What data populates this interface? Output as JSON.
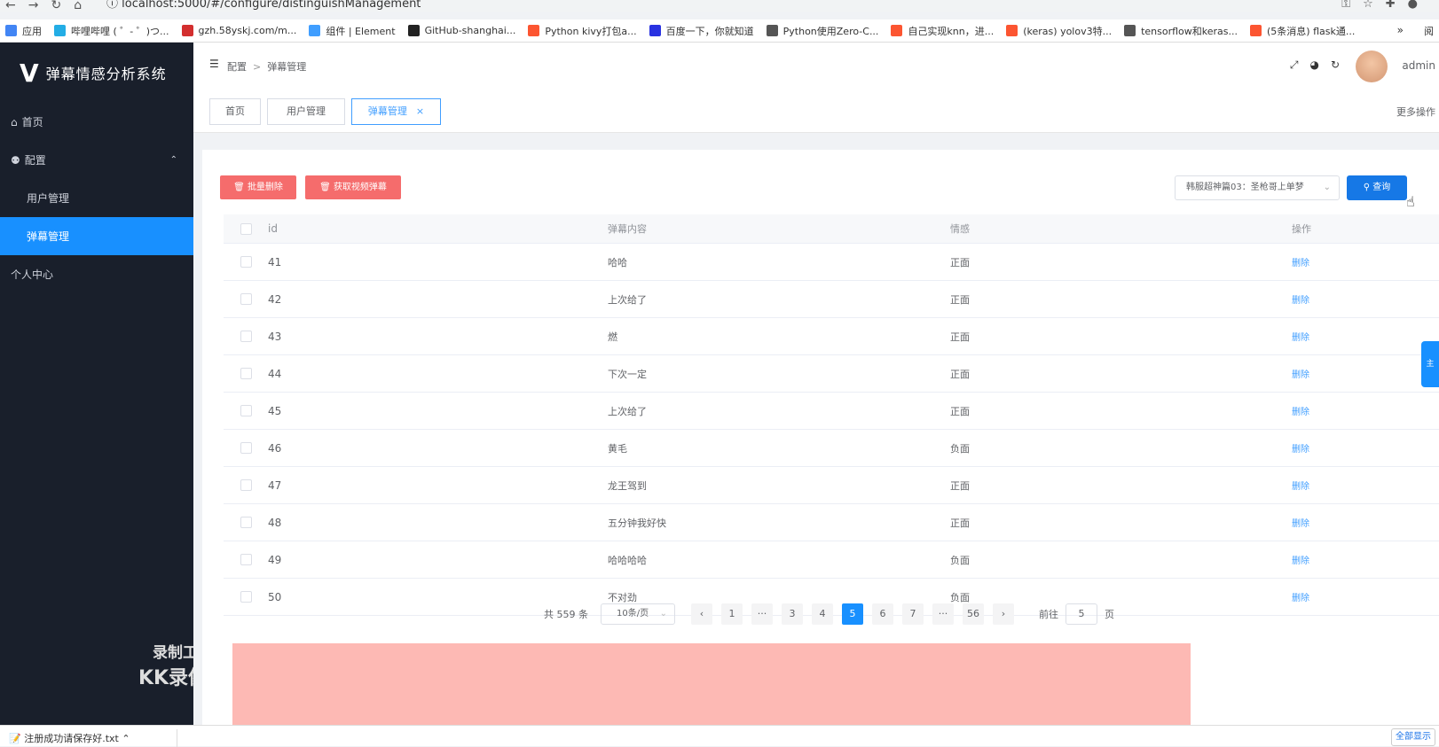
{
  "browser": {
    "url": "localhost:5000/#/configure/distinguishManagement",
    "bookmarks": [
      {
        "label": "应用",
        "color": "#4285f4"
      },
      {
        "label": "哔哩哔哩 ( ゜- ゜)つ...",
        "color": "#23ade5"
      },
      {
        "label": "gzh.58yskj.com/m...",
        "color": "#d32f2f"
      },
      {
        "label": "组件 | Element",
        "color": "#409eff"
      },
      {
        "label": "GitHub-shanghai...",
        "color": "#222222"
      },
      {
        "label": "Python kivy打包a...",
        "color": "#fc5531"
      },
      {
        "label": "百度一下，你就知道",
        "color": "#2932e1"
      },
      {
        "label": "Python使用Zero-C...",
        "color": "#555555"
      },
      {
        "label": "自己实现knn，进...",
        "color": "#fc5531"
      },
      {
        "label": "(keras) yolov3特...",
        "color": "#fc5531"
      },
      {
        "label": "tensorflow和keras...",
        "color": "#555555"
      },
      {
        "label": "(5条消息) flask通...",
        "color": "#fc5531"
      }
    ],
    "bookmark_more": "»",
    "reading_list": "阅"
  },
  "sidebar": {
    "logo_mark": "V",
    "title": "弹幕情感分析系统",
    "items": [
      {
        "label": "首页",
        "icon": "home-icon",
        "glyph": "⌂"
      },
      {
        "label": "配置",
        "icon": "users-icon",
        "glyph": "⚉"
      },
      {
        "label": "用户管理"
      },
      {
        "label": "弹幕管理"
      },
      {
        "label": "个人中心"
      }
    ],
    "expand_arrow": "⌃"
  },
  "watermark": {
    "line1": "录制工具",
    "line2": "KK录像机"
  },
  "header": {
    "breadcrumb": [
      "配置",
      "弹幕管理"
    ],
    "breadcrumb_sep": ">",
    "user": "admin"
  },
  "tags": {
    "items": [
      "首页",
      "用户管理",
      "弹幕管理"
    ],
    "close": "×",
    "more": "更多操作"
  },
  "toolbar": {
    "batch_delete": "批量删除",
    "fetch_video": "获取视频弹幕",
    "select_value": "韩服超神篇03：圣枪哥上单梦",
    "query": "查询"
  },
  "table": {
    "headers": [
      "id",
      "弹幕内容",
      "情感",
      "操作"
    ],
    "rows": [
      {
        "id": "41",
        "content": "哈哈",
        "emotion": "正面",
        "op": "删除"
      },
      {
        "id": "42",
        "content": "上次给了",
        "emotion": "正面",
        "op": "删除"
      },
      {
        "id": "43",
        "content": "燃",
        "emotion": "正面",
        "op": "删除"
      },
      {
        "id": "44",
        "content": "下次一定",
        "emotion": "正面",
        "op": "删除"
      },
      {
        "id": "45",
        "content": "上次给了",
        "emotion": "正面",
        "op": "删除"
      },
      {
        "id": "46",
        "content": "黄毛",
        "emotion": "负面",
        "op": "删除"
      },
      {
        "id": "47",
        "content": "龙王驾到",
        "emotion": "正面",
        "op": "删除"
      },
      {
        "id": "48",
        "content": "五分钟我好快",
        "emotion": "正面",
        "op": "删除"
      },
      {
        "id": "49",
        "content": "哈哈哈哈",
        "emotion": "负面",
        "op": "删除"
      },
      {
        "id": "50",
        "content": "不对劲",
        "emotion": "负面",
        "op": "删除"
      }
    ]
  },
  "pagination": {
    "total": "共 559 条",
    "page_size": "10条/页",
    "prev": "‹",
    "next": "›",
    "pages": [
      "1",
      "···",
      "3",
      "4",
      "5",
      "6",
      "7",
      "···",
      "56"
    ],
    "current": "5",
    "goto_label": "前往",
    "goto_value": "5",
    "goto_suffix": "页"
  },
  "float_tab": "主",
  "download_bar": {
    "file": "注册成功请保存好.txt",
    "show_all": "全部显示"
  }
}
